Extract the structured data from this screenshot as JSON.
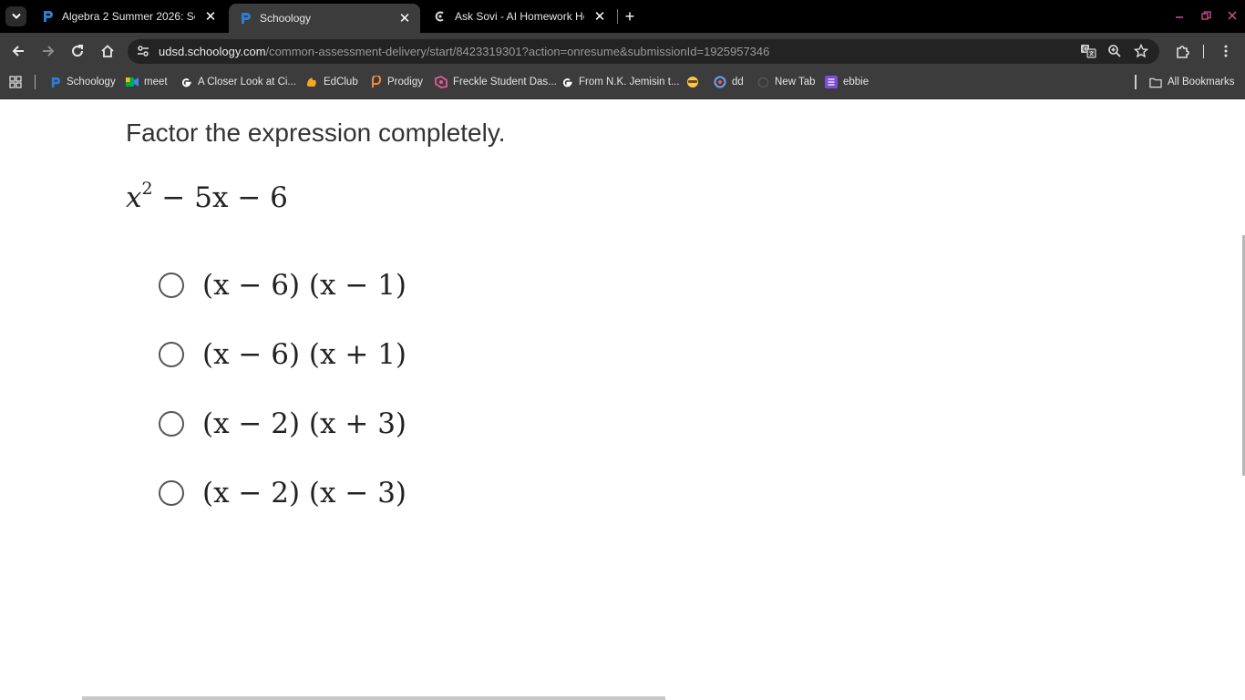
{
  "tabs": [
    {
      "title": "Algebra 2 Summer 2026: Secti",
      "favicon": "schoology-icon",
      "active": false
    },
    {
      "title": "Schoology",
      "favicon": "schoology-icon",
      "active": true
    },
    {
      "title": "Ask Sovi - AI Homework Helper",
      "favicon": "sovi-icon",
      "active": false
    }
  ],
  "close_glyph": "✕",
  "new_tab_glyph": "+",
  "address": {
    "host": "udsd.schoology.com",
    "path": "/common-assessment-delivery/start/8423319301?action=onresume&submissionId=1925957346"
  },
  "bookmarks": [
    {
      "label": "Schoology",
      "icon": "schoology-icon"
    },
    {
      "label": "meet",
      "icon": "meet-icon"
    },
    {
      "label": "A Closer Look at Ci...",
      "icon": "google-icon"
    },
    {
      "label": "EdClub",
      "icon": "edclub-icon"
    },
    {
      "label": "Prodigy",
      "icon": "prodigy-icon"
    },
    {
      "label": "Freckle Student Das...",
      "icon": "freckle-icon"
    },
    {
      "label": "From N.K. Jemisin t...",
      "icon": "google-icon"
    },
    {
      "label": "",
      "icon": "emoji-icon"
    },
    {
      "label": "dd",
      "icon": "dd-icon"
    },
    {
      "label": "New Tab",
      "icon": "newtab-icon"
    },
    {
      "label": "ebbie",
      "icon": "list-icon"
    }
  ],
  "all_bookmarks": "All Bookmarks",
  "question": {
    "prompt": "Factor the expression completely.",
    "expression": {
      "base": "x",
      "exp": "2",
      "rest": " − 5x − 6"
    },
    "options": [
      "(x − 6) (x − 1)",
      "(x − 6) (x + 1)",
      "(x − 2) (x + 3)",
      "(x − 2) (x − 3)"
    ]
  },
  "colors": {
    "chrome_dark": "#000000",
    "toolbar": "#3c3c3c",
    "omnibox": "#232323",
    "schoology_blue": "#2d7dd2"
  }
}
